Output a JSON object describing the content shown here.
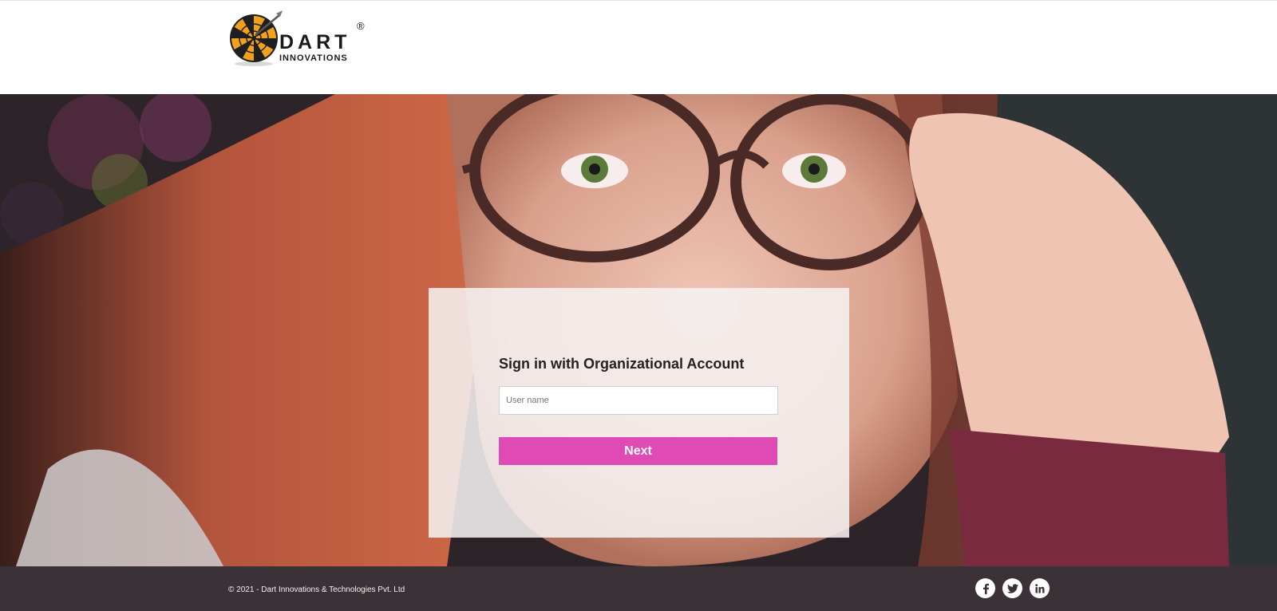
{
  "header": {
    "logo": {
      "icon": "dartboard-icon",
      "word": "DART",
      "subtitle": "INNOVATIONS",
      "registered": "®"
    }
  },
  "login": {
    "title": "Sign in with Organizational Account",
    "username_placeholder": "User name",
    "username_value": "",
    "next_label": "Next"
  },
  "footer": {
    "copyright": "© 2021 - Dart Innovations & Technologies Pvt. Ltd",
    "social": [
      {
        "icon": "facebook-icon"
      },
      {
        "icon": "twitter-icon"
      },
      {
        "icon": "linkedin-icon"
      }
    ]
  },
  "colors": {
    "accent": "#e04ab4",
    "footer_bg": "#3b3237",
    "card_bg": "#f5f1f1"
  }
}
